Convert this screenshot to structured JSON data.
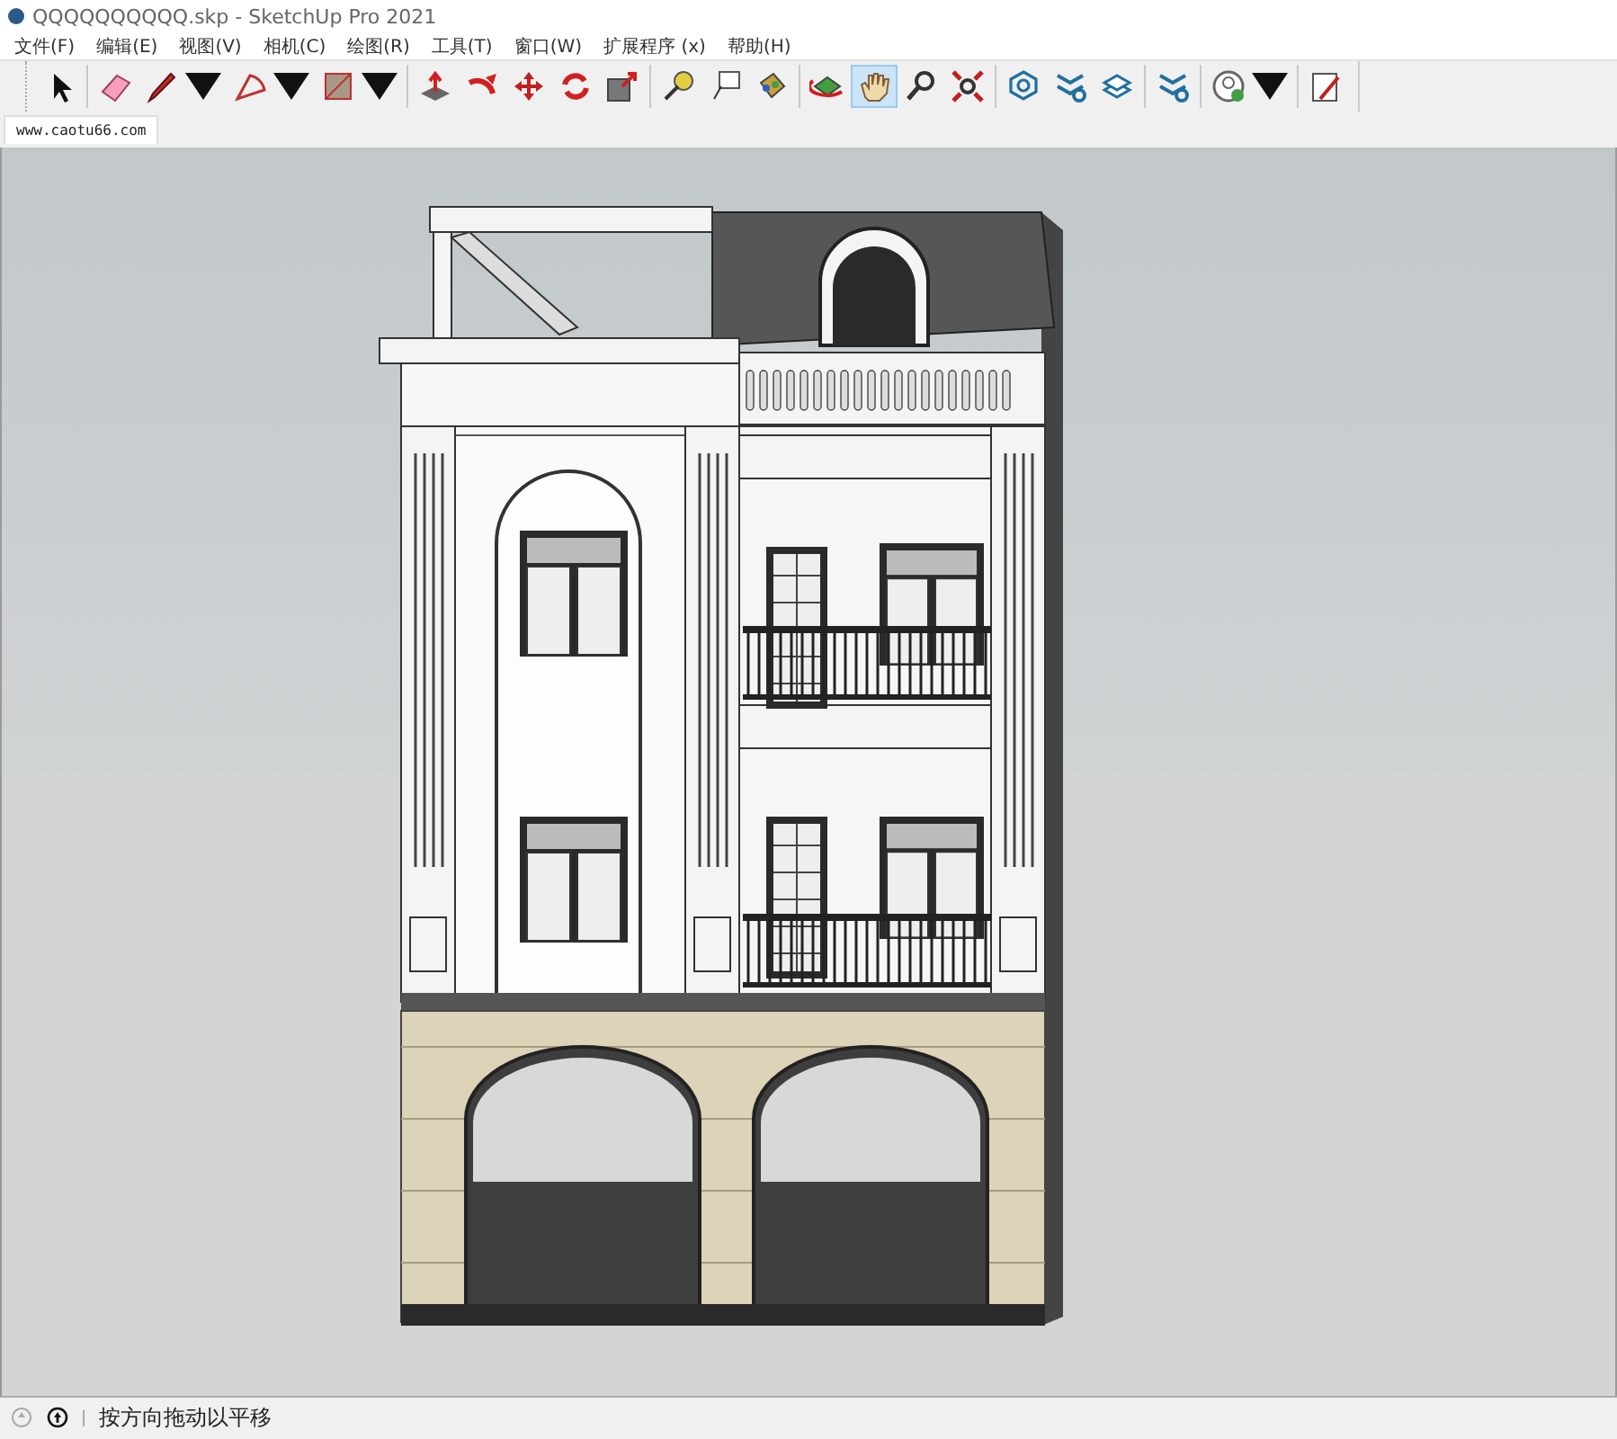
{
  "window": {
    "title": "QQQQQQQQQQ.skp - SketchUp Pro 2021"
  },
  "menu": [
    {
      "label": "文件(F)"
    },
    {
      "label": "编辑(E)"
    },
    {
      "label": "视图(V)"
    },
    {
      "label": "相机(C)"
    },
    {
      "label": "绘图(R)"
    },
    {
      "label": "工具(T)"
    },
    {
      "label": "窗口(W)"
    },
    {
      "label": "扩展程序 (x)"
    },
    {
      "label": "帮助(H)"
    }
  ],
  "toolbar": {
    "groups": [
      [
        {
          "kind": "select",
          "selected": false,
          "dropdown": false
        }
      ],
      [
        {
          "kind": "eraser",
          "selected": false,
          "dropdown": false
        },
        {
          "kind": "pencil",
          "selected": false,
          "dropdown": true
        },
        {
          "kind": "arc",
          "selected": false,
          "dropdown": true
        },
        {
          "kind": "rectangle",
          "selected": false,
          "dropdown": true
        }
      ],
      [
        {
          "kind": "pushpull",
          "selected": false,
          "dropdown": false
        },
        {
          "kind": "followme",
          "selected": false,
          "dropdown": false
        },
        {
          "kind": "move",
          "selected": false,
          "dropdown": false
        },
        {
          "kind": "rotate",
          "selected": false,
          "dropdown": false
        },
        {
          "kind": "scale",
          "selected": false,
          "dropdown": false
        }
      ],
      [
        {
          "kind": "tape",
          "selected": false,
          "dropdown": false
        },
        {
          "kind": "text",
          "selected": false,
          "dropdown": false
        },
        {
          "kind": "paint",
          "selected": false,
          "dropdown": false
        }
      ],
      [
        {
          "kind": "orbit",
          "selected": false,
          "dropdown": false
        },
        {
          "kind": "pan",
          "selected": true,
          "dropdown": false
        },
        {
          "kind": "zoom",
          "selected": false,
          "dropdown": false
        },
        {
          "kind": "extents",
          "selected": false,
          "dropdown": false
        }
      ],
      [
        {
          "kind": "warehouse",
          "selected": false,
          "dropdown": false
        },
        {
          "kind": "extension",
          "selected": false,
          "dropdown": false
        },
        {
          "kind": "layers",
          "selected": false,
          "dropdown": false
        }
      ],
      [
        {
          "kind": "extension2",
          "selected": false,
          "dropdown": false
        }
      ],
      [
        {
          "kind": "profile",
          "selected": false,
          "dropdown": true
        }
      ],
      [
        {
          "kind": "rubyedit",
          "selected": false,
          "dropdown": false
        }
      ]
    ]
  },
  "scene_tabs": [
    {
      "label": "www.caotu66.com",
      "selected": true
    }
  ],
  "status_bar": {
    "text": "按方向拖动以平移"
  }
}
